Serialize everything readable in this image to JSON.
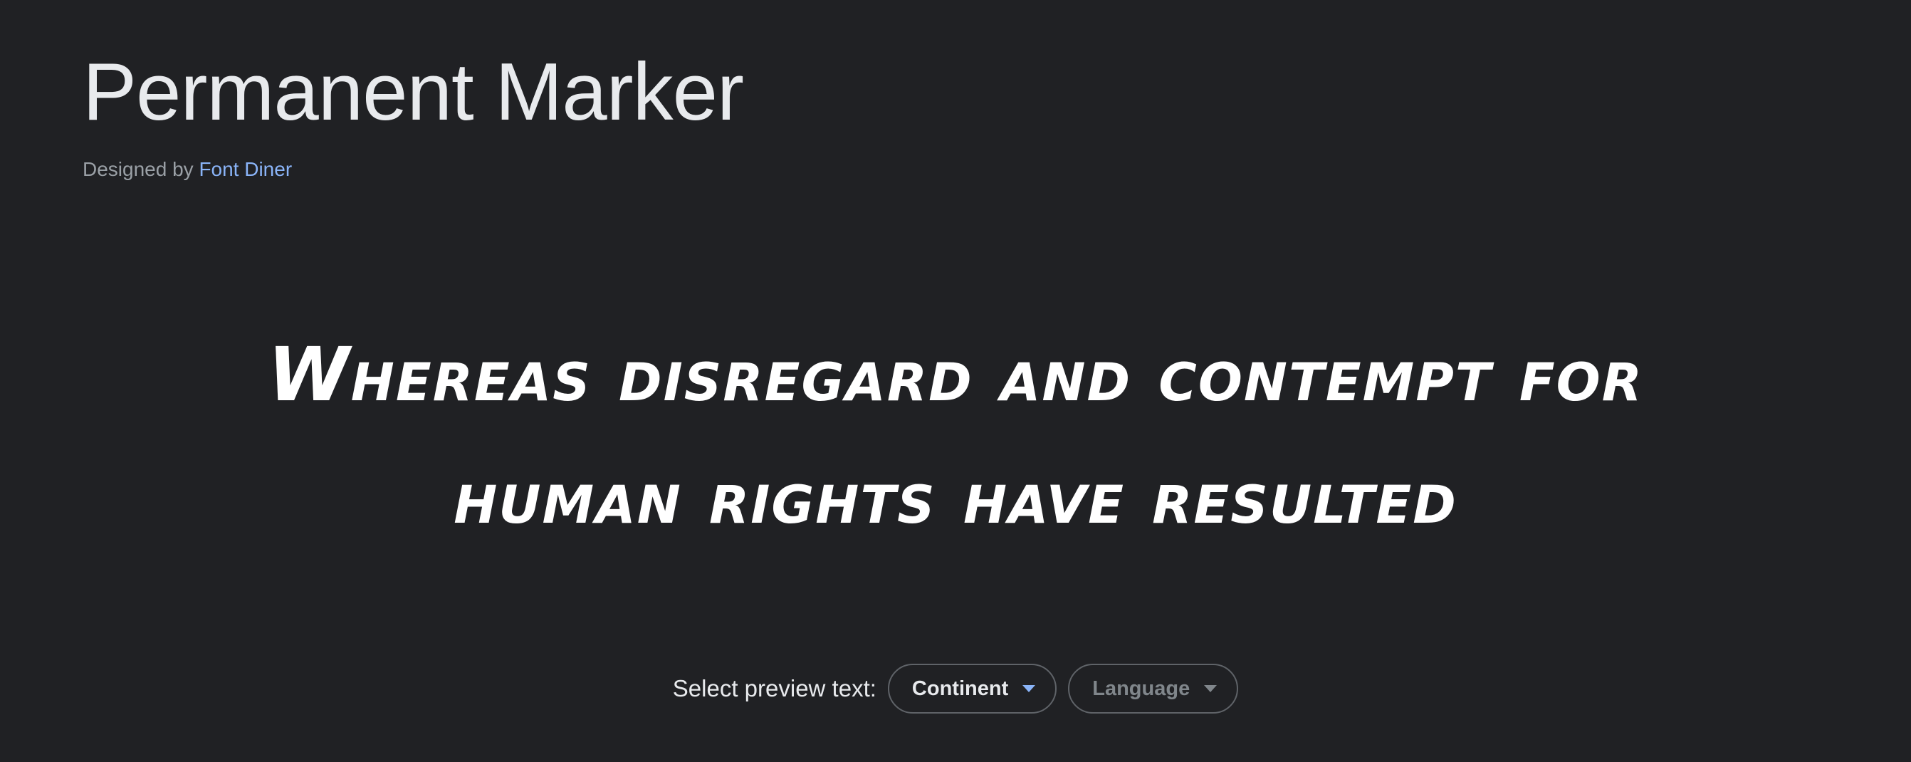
{
  "header": {
    "font_name": "Permanent Marker",
    "designed_by_prefix": "Designed by ",
    "designer": "Font Diner"
  },
  "preview": {
    "line1": "Whereas disregard and contempt for",
    "line2": "human rights have resulted"
  },
  "controls": {
    "label": "Select preview text:",
    "continent": "Continent",
    "language": "Language"
  },
  "colors": {
    "background": "#202124",
    "link": "#8ab4f8",
    "caret_active": "#8ab4f8"
  },
  "icons": {
    "continent_caret": "caret-down-icon",
    "language_caret": "caret-down-icon"
  }
}
